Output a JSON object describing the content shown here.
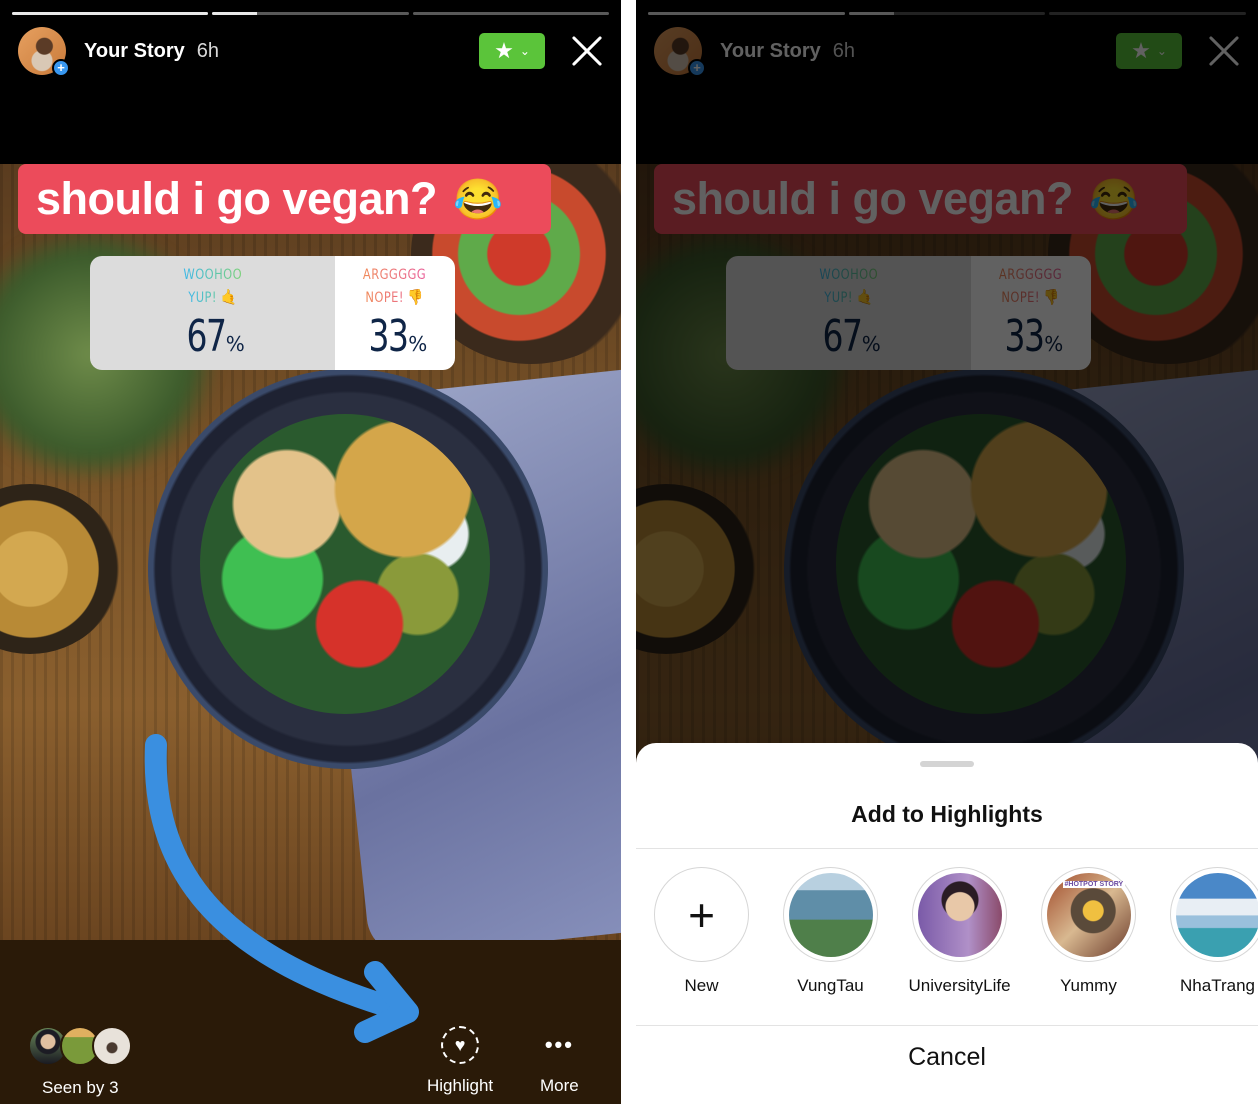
{
  "story": {
    "name": "Your Story",
    "time": "6h",
    "progress": [
      1.0,
      0.23,
      0.0
    ],
    "close_friends_badge": "star-icon",
    "close_label": "close-icon"
  },
  "sticker": {
    "question": "should i go vegan?",
    "emoji": "😂"
  },
  "poll": {
    "options": [
      {
        "line1": "WOOHOO",
        "line2": "YUP!",
        "emoji": "🤙",
        "percent": 67,
        "percent_sign": "%"
      },
      {
        "line1": "ARGGGGG",
        "line2": "NOPE!",
        "emoji": "👎",
        "percent": 33,
        "percent_sign": "%"
      }
    ]
  },
  "footer": {
    "seen_label": "Seen by 3",
    "highlight_label": "Highlight",
    "more_label": "More",
    "more_icon": "•••",
    "heart_icon": "♥"
  },
  "sheet": {
    "title": "Add to Highlights",
    "new_icon": "+",
    "highlights": [
      {
        "label": "New"
      },
      {
        "label": "VungTau"
      },
      {
        "label": "UniversityLife"
      },
      {
        "label": "Yummy",
        "tag": "#HOTPOT STORY"
      },
      {
        "label": "NhaTrang"
      }
    ],
    "cancel_label": "Cancel"
  },
  "colors": {
    "sticker_bg": "#ec4b5b",
    "close_friends_green": "#5bc43a",
    "annotation_arrow": "#3a8fe0",
    "footer_bg": "#2a1a08"
  }
}
